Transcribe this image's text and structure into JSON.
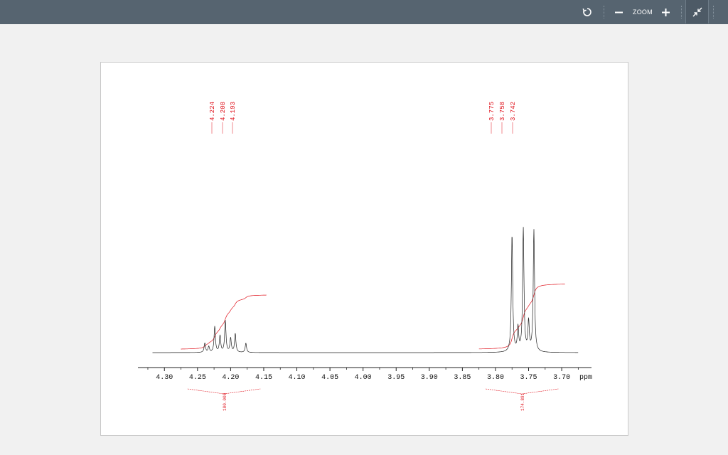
{
  "toolbar": {
    "zoom_label": "ZOOM",
    "icons": [
      "refresh-icon",
      "zoom-out-icon",
      "zoom-in-icon",
      "collapse-icon"
    ]
  },
  "colors": {
    "toolbar": "#566470",
    "spectrum": "#222222",
    "annotation": "#e0141e"
  },
  "chart_data": {
    "type": "line",
    "xlabel": "ppm",
    "xlim": [
      4.34,
      3.655
    ],
    "x_ticks": [
      "4.30",
      "4.25",
      "4.20",
      "4.15",
      "4.10",
      "4.05",
      "4.00",
      "3.95",
      "3.90",
      "3.85",
      "3.80",
      "3.75",
      "3.70"
    ],
    "peak_labels": [
      "4.224",
      "4.208",
      "4.193",
      "3.775",
      "3.758",
      "3.742"
    ],
    "integrals": [
      {
        "label": "100.000",
        "from": 4.265,
        "to": 4.155
      },
      {
        "label": "174.891",
        "from": 3.815,
        "to": 3.705
      }
    ],
    "peaks": [
      {
        "ppm": 4.239,
        "height": 0.08
      },
      {
        "ppm": 4.233,
        "height": 0.05
      },
      {
        "ppm": 4.224,
        "height": 0.22
      },
      {
        "ppm": 4.216,
        "height": 0.14
      },
      {
        "ppm": 4.208,
        "height": 0.27
      },
      {
        "ppm": 4.2,
        "height": 0.12
      },
      {
        "ppm": 4.193,
        "height": 0.16
      },
      {
        "ppm": 4.177,
        "height": 0.08
      },
      {
        "ppm": 3.775,
        "height": 1.0
      },
      {
        "ppm": 3.766,
        "height": 0.2
      },
      {
        "ppm": 3.758,
        "height": 1.05
      },
      {
        "ppm": 3.75,
        "height": 0.25
      },
      {
        "ppm": 3.742,
        "height": 1.04
      }
    ]
  }
}
